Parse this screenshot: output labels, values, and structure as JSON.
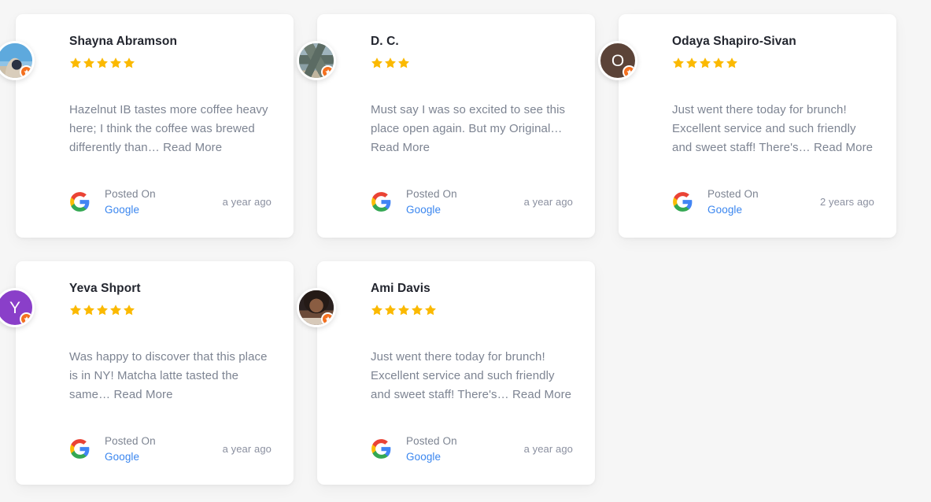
{
  "theme": {
    "page_background": "#f6f6f6",
    "card_background": "#ffffff",
    "star_color": "#fbb900",
    "link_color": "#3a86ef",
    "body_text_color": "#7d8492",
    "name_text_color": "#23262f",
    "badge_color": "#f4701f"
  },
  "common": {
    "posted_on_label": "Posted On",
    "source_name": "Google",
    "read_more_label": "Read More",
    "source_icon": "google-logo-icon",
    "badge_icon": "verified-star-badge-icon",
    "star_icon": "star-icon"
  },
  "reviews": [
    {
      "name": "Shayna Abramson",
      "rating": 5,
      "avatar_type": "photo",
      "avatar_photo": "photo-beach",
      "avatar_initial": "",
      "avatar_background": "#5ea9dd",
      "text": "Hazelnut IB tastes more coffee heavy here; I think the coffee was brewed differently than…",
      "read_more_label": "Read More",
      "posted_on_label": "Posted On",
      "source_name": "Google",
      "age": "a year ago"
    },
    {
      "name": "D. C.",
      "rating": 3,
      "avatar_type": "photo",
      "avatar_photo": "photo-mountain",
      "avatar_initial": "",
      "avatar_background": "#6e7d72",
      "text": "Must say I was so excited to see this place open again. But my Original…",
      "read_more_label": "Read More",
      "posted_on_label": "Posted On",
      "source_name": "Google",
      "age": "a year ago"
    },
    {
      "name": "Odaya Shapiro-Sivan",
      "rating": 5,
      "avatar_type": "initial",
      "avatar_photo": "",
      "avatar_initial": "O",
      "avatar_background": "#5b4338",
      "text": "Just went there today for brunch! Excellent service and such friendly and sweet staff! There's…",
      "read_more_label": "Read More",
      "posted_on_label": "Posted On",
      "source_name": "Google",
      "age": "2 years ago"
    },
    {
      "name": "Yeva Shport",
      "rating": 5,
      "avatar_type": "initial",
      "avatar_photo": "",
      "avatar_initial": "Y",
      "avatar_background": "#8a3fc9",
      "text": "Was happy to discover that this place is in NY! Matcha latte tasted the same…",
      "read_more_label": "Read More",
      "posted_on_label": "Posted On",
      "source_name": "Google",
      "age": "a year ago"
    },
    {
      "name": "Ami Davis",
      "rating": 5,
      "avatar_type": "photo",
      "avatar_photo": "photo-portrait",
      "avatar_initial": "",
      "avatar_background": "#2a2120",
      "text": "Just went there today for brunch! Excellent service and such friendly and sweet staff! There's…",
      "read_more_label": "Read More",
      "posted_on_label": "Posted On",
      "source_name": "Google",
      "age": "a year ago"
    }
  ]
}
